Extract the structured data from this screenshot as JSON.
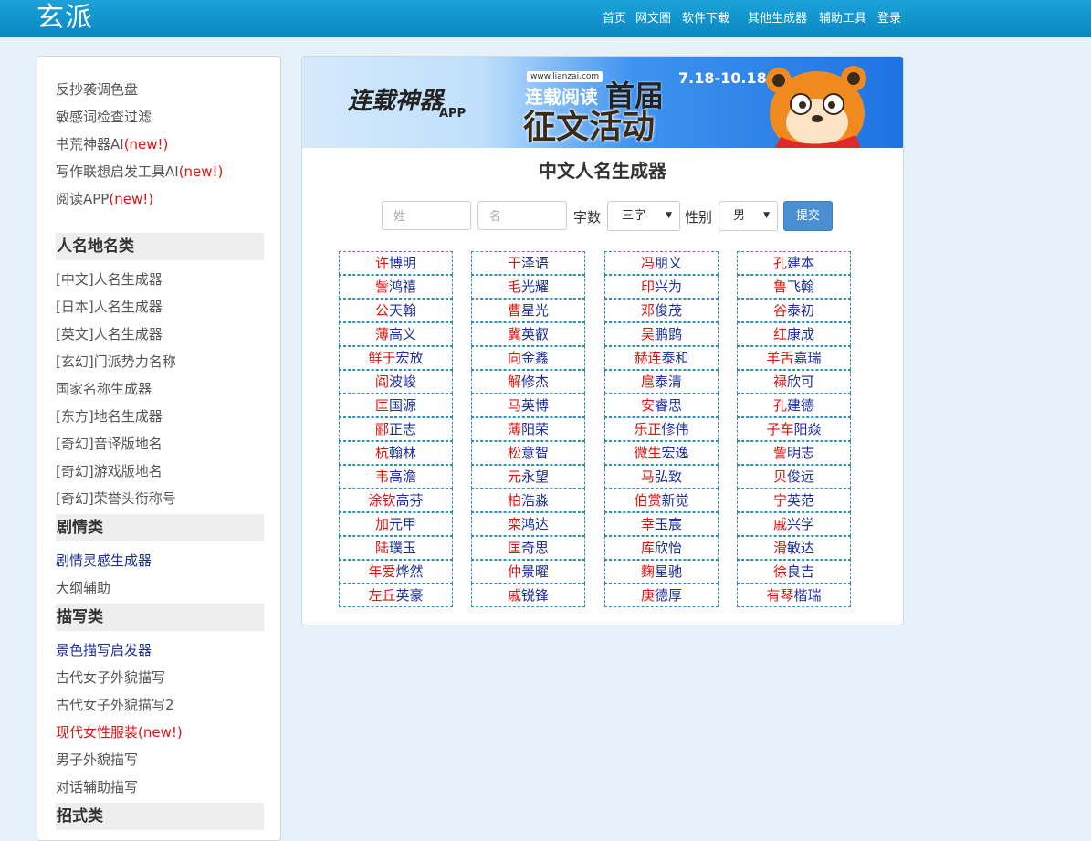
{
  "header": {
    "logo": "玄派",
    "nav": [
      "首页",
      "网文圈",
      "软件下载",
      "其他生成器",
      "辅助工具",
      "登录"
    ]
  },
  "sidebar": {
    "top_links": [
      {
        "text": "反抄袭调色盘",
        "new": ""
      },
      {
        "text": "敏感词检查过滤",
        "new": ""
      },
      {
        "text": "书荒神器AI",
        "new": "(new!)"
      },
      {
        "text": "写作联想启发工具AI",
        "new": "(new!)"
      },
      {
        "text": "阅读APP",
        "new": "(new!)"
      }
    ],
    "sections": [
      {
        "heading": "人名地名类",
        "links": [
          {
            "text": "[中文]人名生成器",
            "new": ""
          },
          {
            "text": "[日本]人名生成器",
            "new": ""
          },
          {
            "text": "[英文]人名生成器",
            "new": ""
          },
          {
            "text": "[玄幻]门派势力名称",
            "new": ""
          },
          {
            "text": "国家名称生成器",
            "new": ""
          },
          {
            "text": "[东方]地名生成器",
            "new": ""
          },
          {
            "text": "[奇幻]音译版地名",
            "new": ""
          },
          {
            "text": "[奇幻]游戏版地名",
            "new": ""
          },
          {
            "text": "[奇幻]荣誉头衔称号",
            "new": ""
          }
        ]
      },
      {
        "heading": "剧情类",
        "links": [
          {
            "text": "剧情灵感生成器",
            "new": ""
          },
          {
            "text": "大纲辅助",
            "new": ""
          }
        ]
      },
      {
        "heading": "描写类",
        "links": [
          {
            "text": "景色描写启发器",
            "new": ""
          },
          {
            "text": "古代女子外貌描写",
            "new": ""
          },
          {
            "text": "古代女子外貌描写2",
            "new": ""
          },
          {
            "text": "现代女性服装",
            "new": "(new!)"
          },
          {
            "text": "男子外貌描写",
            "new": ""
          },
          {
            "text": "对话辅助描写",
            "new": ""
          }
        ]
      },
      {
        "heading": "招式类",
        "links": []
      }
    ]
  },
  "banner": {
    "app_title": "连载神器",
    "app_sub": "APP",
    "url": "www.lianzai.com",
    "line1": "连载阅读",
    "line1_big": "首届",
    "line2": "征文活动",
    "dates": "7.18-10.18"
  },
  "main": {
    "title": "中文人名生成器",
    "form": {
      "surname_placeholder": "姓",
      "given_placeholder": "名",
      "count_label": "字数",
      "count_value": "三字",
      "gender_label": "性别",
      "gender_value": "男",
      "submit_label": "提交"
    },
    "names": [
      [
        [
          "许",
          "博明"
        ],
        [
          "訾",
          "鸿禧"
        ],
        [
          "公",
          "天翰"
        ],
        [
          "薄",
          "高义"
        ],
        [
          "鲜于",
          "宏放"
        ],
        [
          "阎",
          "波峻"
        ],
        [
          "匡",
          "国源"
        ],
        [
          "郦",
          "正志"
        ],
        [
          "杭",
          "翰林"
        ],
        [
          "韦",
          "高澹"
        ],
        [
          "涂钦",
          "高芬"
        ],
        [
          "加",
          "元甲"
        ],
        [
          "陆",
          "璞玉"
        ],
        [
          "年爱",
          "烨然"
        ],
        [
          "左丘",
          "英豪"
        ]
      ],
      [
        [
          "干",
          "泽语"
        ],
        [
          "毛",
          "光耀"
        ],
        [
          "曹",
          "星光"
        ],
        [
          "冀",
          "英叡"
        ],
        [
          "向",
          "金鑫"
        ],
        [
          "解",
          "修杰"
        ],
        [
          "马",
          "英博"
        ],
        [
          "薄",
          "阳荣"
        ],
        [
          "松",
          "意智"
        ],
        [
          "元",
          "永望"
        ],
        [
          "柏",
          "浩淼"
        ],
        [
          "栾",
          "鸿达"
        ],
        [
          "匡",
          "奇思"
        ],
        [
          "仲",
          "景曜"
        ],
        [
          "戚",
          "锐锋"
        ]
      ],
      [
        [
          "冯",
          "朋义"
        ],
        [
          "印",
          "兴为"
        ],
        [
          "邓",
          "俊茂"
        ],
        [
          "吴",
          "鹏鹍"
        ],
        [
          "赫连",
          "泰和"
        ],
        [
          "扈",
          "泰清"
        ],
        [
          "安",
          "睿思"
        ],
        [
          "乐正",
          "修伟"
        ],
        [
          "微生",
          "宏逸"
        ],
        [
          "马",
          "弘致"
        ],
        [
          "伯赏",
          "新觉"
        ],
        [
          "幸",
          "玉宸"
        ],
        [
          "库",
          "欣怡"
        ],
        [
          "麴",
          "星驰"
        ],
        [
          "庚",
          "德厚"
        ]
      ],
      [
        [
          "孔",
          "建本"
        ],
        [
          "鲁",
          "飞翰"
        ],
        [
          "谷",
          "泰初"
        ],
        [
          "红",
          "康成"
        ],
        [
          "羊舌",
          "嘉瑞"
        ],
        [
          "禄",
          "欣可"
        ],
        [
          "孔",
          "建德"
        ],
        [
          "子车",
          "阳焱"
        ],
        [
          "訾",
          "明志"
        ],
        [
          "贝",
          "俊远"
        ],
        [
          "宁",
          "英范"
        ],
        [
          "戚",
          "兴学"
        ],
        [
          "滑",
          "敏达"
        ],
        [
          "徐",
          "良吉"
        ],
        [
          "有琴",
          "楷瑞"
        ]
      ]
    ]
  }
}
